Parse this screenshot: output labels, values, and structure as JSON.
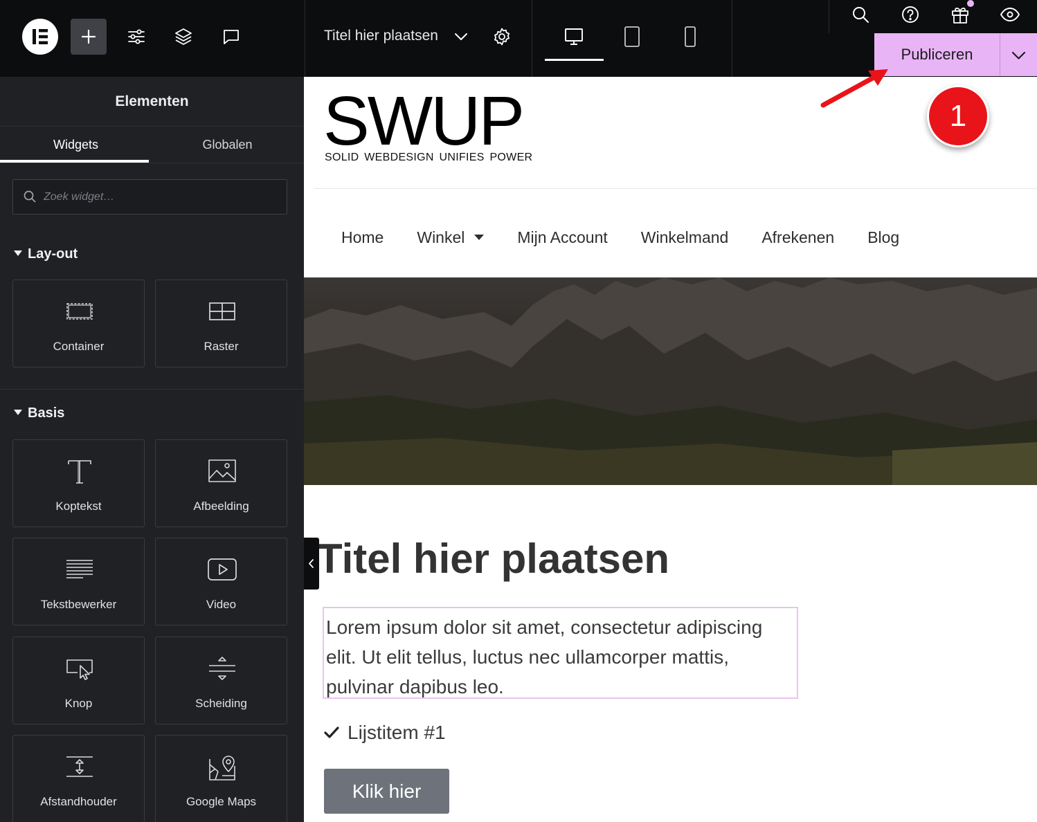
{
  "topbar": {
    "page_title": "Titel hier plaatsen",
    "publish_label": "Publiceren",
    "icons": [
      "elementor-logo-icon",
      "plus-icon",
      "sliders-icon",
      "layers-icon",
      "comment-icon",
      "chevron-down-icon",
      "gear-icon",
      "desktop-icon",
      "tablet-icon",
      "mobile-icon",
      "search-icon",
      "help-icon",
      "gift-icon",
      "eye-icon"
    ]
  },
  "sidebar": {
    "title": "Elementen",
    "tabs": [
      {
        "label": "Widgets",
        "active": true
      },
      {
        "label": "Globalen",
        "active": false
      }
    ],
    "search_placeholder": "Zoek widget…",
    "sections": [
      {
        "title": "Lay-out",
        "widgets": [
          {
            "label": "Container",
            "icon": "container-icon"
          },
          {
            "label": "Raster",
            "icon": "grid-icon"
          }
        ]
      },
      {
        "title": "Basis",
        "widgets": [
          {
            "label": "Koptekst",
            "icon": "heading-icon"
          },
          {
            "label": "Afbeelding",
            "icon": "image-icon"
          },
          {
            "label": "Tekstbewerker",
            "icon": "text-editor-icon"
          },
          {
            "label": "Video",
            "icon": "video-icon"
          },
          {
            "label": "Knop",
            "icon": "button-icon"
          },
          {
            "label": "Scheiding",
            "icon": "divider-icon"
          },
          {
            "label": "Afstandhouder",
            "icon": "spacer-icon"
          },
          {
            "label": "Google Maps",
            "icon": "map-icon"
          }
        ]
      }
    ]
  },
  "site": {
    "logo_main": "SWUP",
    "logo_sub": "SOLID WEBDESIGN UNIFIES POWER",
    "nav": [
      "Home",
      "Winkel",
      "Mijn Account",
      "Winkelmand",
      "Afrekenen",
      "Blog"
    ],
    "heading": "Titel hier plaatsen",
    "paragraph": "Lorem ipsum dolor sit amet, consectetur adipiscing elit. Ut elit tellus, luctus nec ullamcorper mattis, pulvinar dapibus leo.",
    "list_item": "Lijstitem #1",
    "button_label": "Klik hier"
  },
  "annotation": {
    "badge_number": "1"
  },
  "colors": {
    "publish_bg": "#e9b4f5",
    "topbar_bg": "#0c0d0e",
    "sidebar_bg": "#202124",
    "badge_red": "#e8141a",
    "selection_outline": "#ecc2f2"
  }
}
